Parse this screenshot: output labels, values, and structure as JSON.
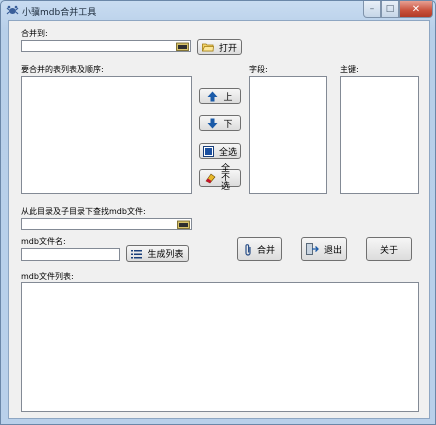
{
  "window": {
    "title": "小骥mdb合并工具"
  },
  "labels": {
    "merge_to": "合并到:",
    "tables_order": "要合并的表列表及顺序:",
    "fields": "字段:",
    "primary_key": "主键:",
    "search_dir": "从此目录及子目录下查找mdb文件:",
    "mdb_name": "mdb文件名:",
    "mdb_list": "mdb文件列表:"
  },
  "inputs": {
    "merge_to_value": "",
    "search_dir_value": "",
    "mdb_name_value": ""
  },
  "buttons": {
    "open": "打开",
    "up": "上",
    "down": "下",
    "select_all": "全选",
    "select_none": "全不选",
    "generate_list": "生成列表",
    "merge": "合并",
    "exit": "退出",
    "about": "关于"
  },
  "icons": {
    "app": "crab-icon",
    "folder": "folder-open-icon",
    "up": "arrow-up-icon",
    "down": "arrow-down-icon",
    "select_all": "checkbox-filled-icon",
    "select_none": "eraser-icon",
    "list": "list-icon",
    "merge": "paperclip-icon",
    "exit": "door-exit-icon"
  },
  "colors": {
    "accent_blue": "#1a5aa8",
    "close_red": "#c8503b"
  }
}
